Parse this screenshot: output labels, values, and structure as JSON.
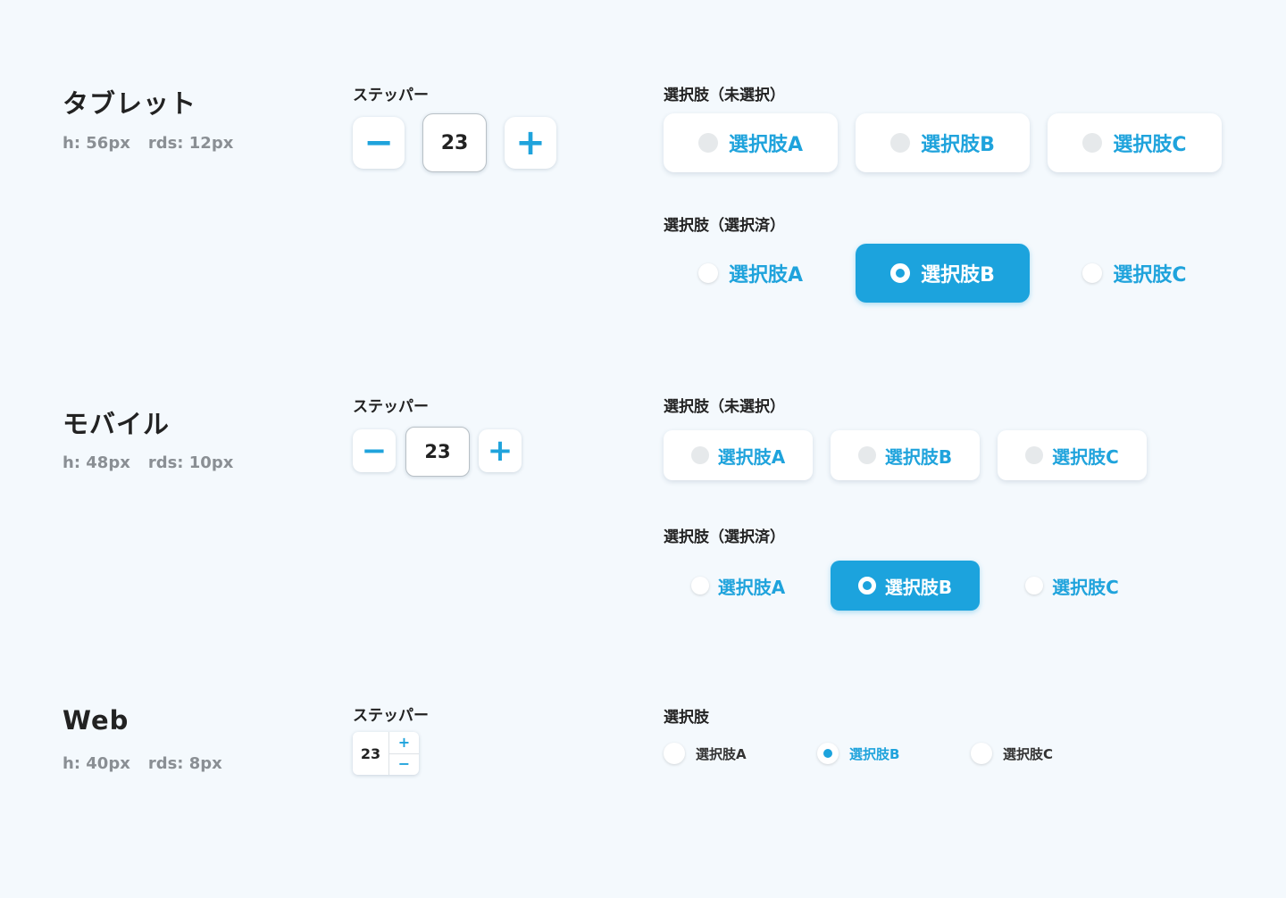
{
  "tablet": {
    "title": "タブレット",
    "height": "h: 56px",
    "radius": "rds: 12px",
    "stepper_label": "ステッパー",
    "stepper_value": "23",
    "minus": "−",
    "plus": "+",
    "unselected_label": "選択肢（未選択）",
    "selected_label": "選択肢（選択済）",
    "options": [
      "選択肢A",
      "選択肢B",
      "選択肢C"
    ],
    "selected_index": 1
  },
  "mobile": {
    "title": "モバイル",
    "height": "h: 48px",
    "radius": "rds: 10px",
    "stepper_label": "ステッパー",
    "stepper_value": "23",
    "minus": "−",
    "plus": "+",
    "unselected_label": "選択肢（未選択）",
    "selected_label": "選択肢（選択済）",
    "options": [
      "選択肢A",
      "選択肢B",
      "選択肢C"
    ],
    "selected_index": 1
  },
  "web": {
    "title": "Web",
    "height": "h: 40px",
    "radius": "rds: 8px",
    "stepper_label": "ステッパー",
    "stepper_value": "23",
    "plus": "+",
    "minus": "−",
    "choices_label": "選択肢",
    "options": [
      "選択肢A",
      "選択肢B",
      "選択肢C"
    ],
    "selected_index": 1
  },
  "colors": {
    "accent": "#1ca3dd",
    "background": "#f4f9fd"
  }
}
